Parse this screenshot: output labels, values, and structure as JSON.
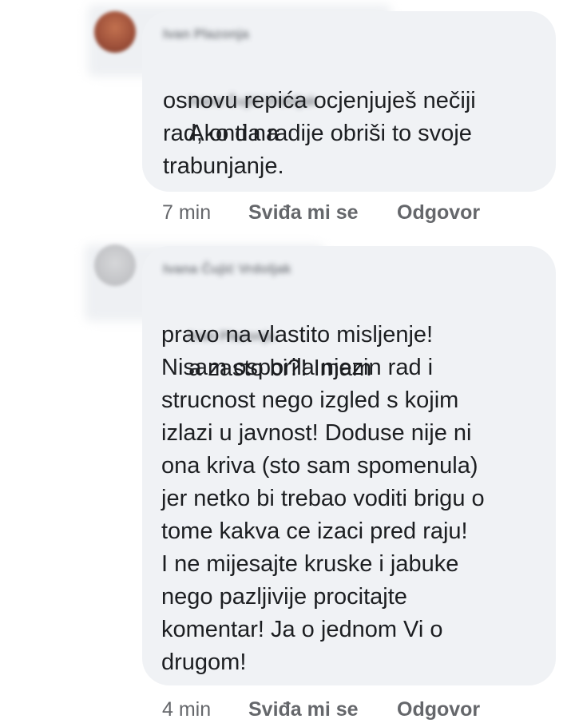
{
  "comments": [
    {
      "author": "Ivan Plazonja",
      "reply_to": "Ivana Čujić Vrdoljak",
      "text_first": "Ako ti na",
      "text_rest": "osnovu repića ocjenjuješ nečiji\nrad, onda radije obriši to svoje\ntrabunjanje.",
      "time": "7 min",
      "like": "Sviđa mi se",
      "reply": "Odgovor",
      "avatar_color": "#a0523b"
    },
    {
      "author": "Ivana Čujić Vrdoljak",
      "reply_to": "Ivan Plazonja",
      "text_first": "a zasto bi?! Imam",
      "text_rest": "pravo na vlastito misljenje!\nNisam osporila njezin rad i\nstrucnost nego izgled s kojim\nizlazi u javnost! Doduse nije ni\nona kriva (sto sam spomenula)\njer netko bi trebao voditi brigu o\ntome kakva ce izaci pred raju!\nI ne mijesajte kruske i jabuke\nnego pazljivije procitajte\nkomentar! Ja o jednom Vi o\ndrugom!",
      "time": "4 min",
      "like": "Sviđa mi se",
      "reply": "Odgovor",
      "avatar_color": "#c9cacc"
    }
  ]
}
